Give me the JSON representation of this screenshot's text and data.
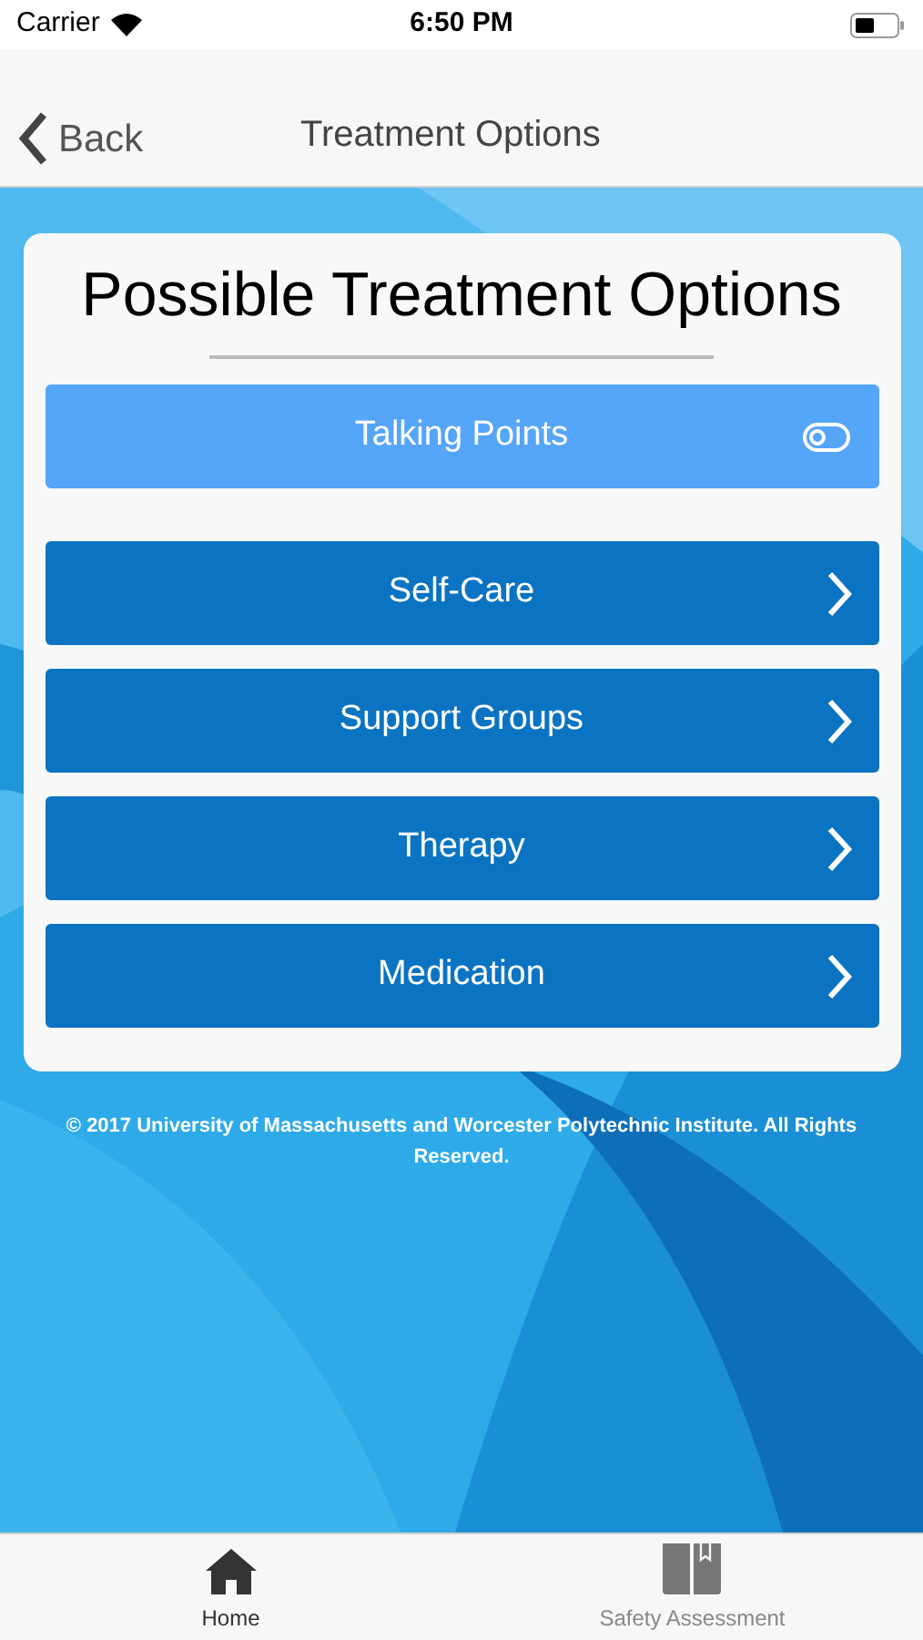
{
  "status_bar": {
    "carrier": "Carrier",
    "time": "6:50 PM"
  },
  "nav_bar": {
    "back": "Back",
    "title": "Treatment Options"
  },
  "card": {
    "title": "Possible Treatment Options",
    "talking_points": {
      "label": "Talking Points",
      "on": false
    },
    "items": [
      {
        "label": "Self-Care"
      },
      {
        "label": "Support Groups"
      },
      {
        "label": "Therapy"
      },
      {
        "label": "Medication"
      }
    ]
  },
  "copyright": "© 2017 University of Massachusetts and Worcester Polytechnic Institute. All Rights Reserved.",
  "tab_bar": [
    {
      "label": "Home",
      "kind": "home",
      "selected": true
    },
    {
      "label": "Safety Assessment",
      "kind": "book",
      "selected": false
    }
  ]
}
